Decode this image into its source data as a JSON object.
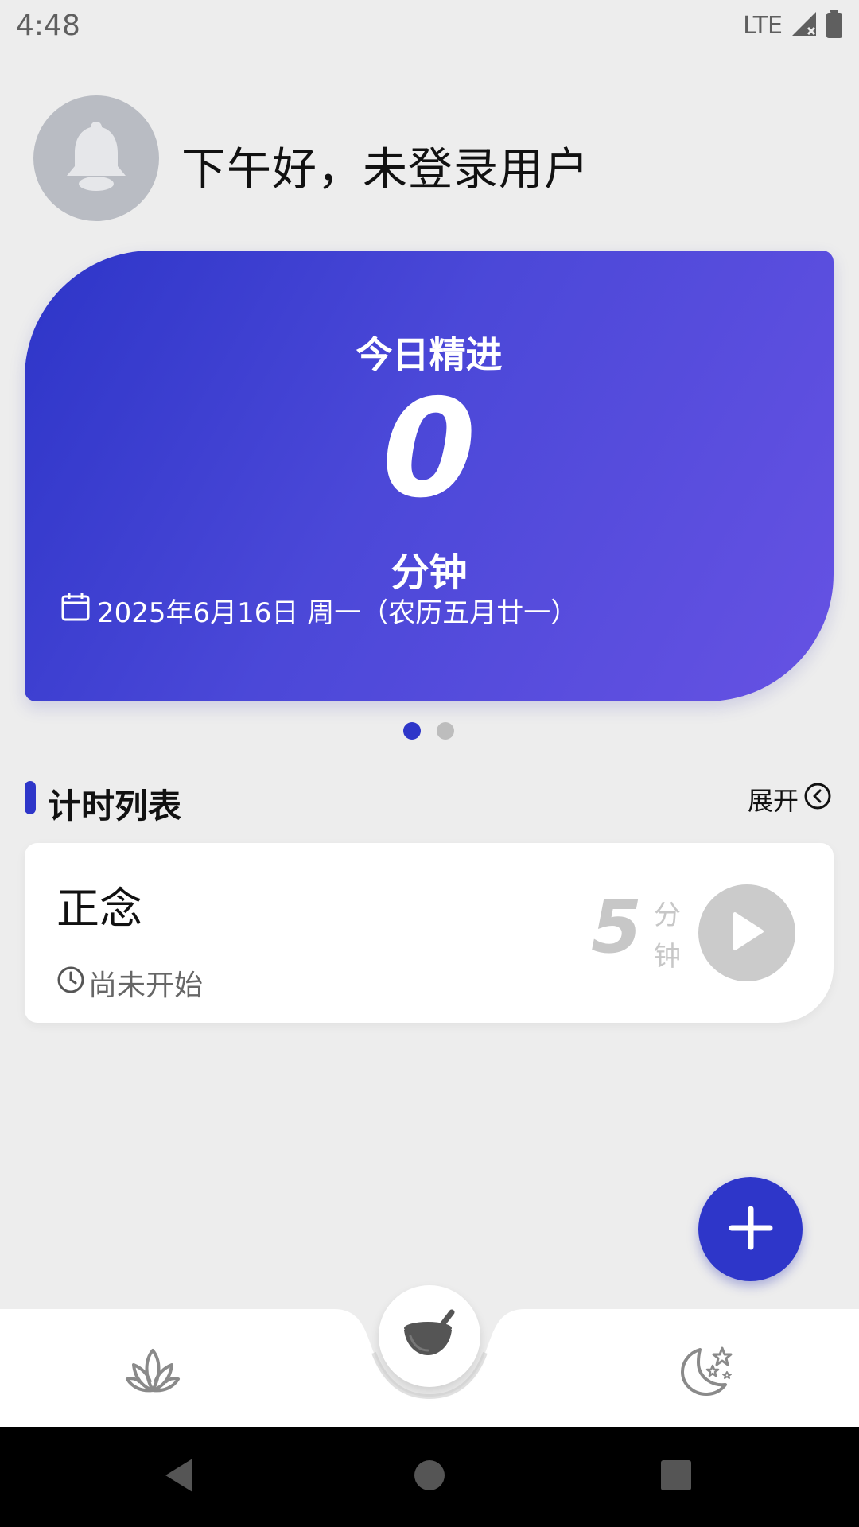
{
  "status_bar": {
    "time": "4:48",
    "network": "LTE"
  },
  "header": {
    "avatar_icon": "bell-icon",
    "greeting": "下午好，未登录用户"
  },
  "hero_card": {
    "title": "今日精进",
    "value": "0",
    "unit": "分钟",
    "date": "2025年6月16日 周一（农历五月廿一）",
    "gradient_start": "#2d35c8",
    "gradient_end": "#6652e3"
  },
  "pager": {
    "count": 2,
    "active": 0
  },
  "section": {
    "title": "计时列表",
    "expand_label": "展开"
  },
  "timers": [
    {
      "name": "正念",
      "status": "尚未开始",
      "minutes": "5",
      "unit_line1": "分",
      "unit_line2": "钟"
    }
  ],
  "bottom_nav": {
    "items": [
      "lotus-icon",
      "bowl-icon",
      "moon-stars-icon"
    ],
    "active": 1
  },
  "colors": {
    "accent": "#2e36c9",
    "background": "#ededed"
  }
}
